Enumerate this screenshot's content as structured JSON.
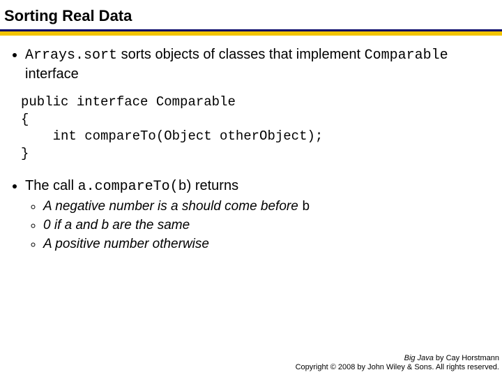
{
  "title": "Sorting Real Data",
  "bullet1": {
    "code1": "Arrays.sort",
    "mid": " sorts objects of classes that implement ",
    "code2": "Comparable",
    "tail": " interface"
  },
  "code": "public interface Comparable\n{\n    int compareTo(Object otherObject);\n}",
  "bullet2": {
    "pre": "The call ",
    "code": "a.compareTo(b",
    "post": ") returns",
    "subs": {
      "a_pre": "A negative number is a should come before ",
      "a_code": "b",
      "b": "0 if a and b are the same",
      "c": "A positive number otherwise"
    }
  },
  "footer": {
    "line1_em": "Big Java",
    "line1_rest": " by Cay Horstmann",
    "line2": "Copyright © 2008 by John Wiley & Sons. All rights reserved."
  }
}
